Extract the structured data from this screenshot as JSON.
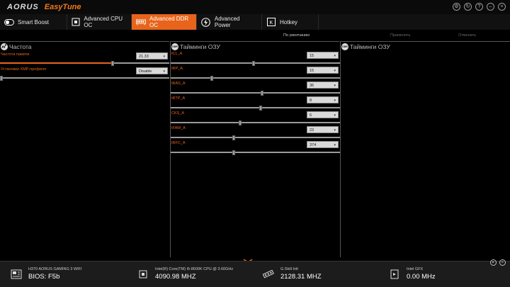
{
  "app": {
    "brand": "AORUS",
    "product": "EasyTune"
  },
  "window_controls": [
    "gear-icon",
    "refresh-icon",
    "help-icon",
    "minimize-icon",
    "close-icon"
  ],
  "tabs": [
    {
      "label": "Smart Boost",
      "icon": "toggle-icon"
    },
    {
      "label": "Advanced CPU OC",
      "icon": "cpu-icon"
    },
    {
      "label": "Advanced DDR OC",
      "icon": "ram-icon",
      "active": true
    },
    {
      "label": "Advanced Power",
      "icon": "lightning-icon"
    },
    {
      "label": "Hotkey",
      "icon": "keyboard-icon"
    }
  ],
  "actions": {
    "default": "По умолчанию",
    "apply": "Применить",
    "cancel": "Отменить"
  },
  "panel_frequency": {
    "title": "Частота",
    "memory_frequency": {
      "label": "Частота памяти",
      "value": "21.33",
      "slider": 0.67
    },
    "xmp_profile": {
      "label": "Установки XMP-профиля",
      "value": "Disable",
      "slider": 0.0
    }
  },
  "panel_timings": {
    "title": "Тайминги ОЗУ",
    "badge": "DDR",
    "rows": [
      {
        "label": "tCL_A",
        "value": "15",
        "slider": 0.49
      },
      {
        "label": "tRP_A",
        "value": "15",
        "slider": 0.24
      },
      {
        "label": "tRAS_A",
        "value": "36",
        "slider": 0.54
      },
      {
        "label": "tRTP_A",
        "value": "8",
        "slider": 0.53
      },
      {
        "label": "CKS_A",
        "value": "6",
        "slider": 0.41
      },
      {
        "label": "tFAW_A",
        "value": "23",
        "slider": 0.37
      },
      {
        "label": "tRFC_A",
        "value": "374",
        "slider": 0.37
      }
    ]
  },
  "panel_timings2": {
    "title": "Тайминги ОЗУ",
    "badge": "DDR"
  },
  "footer": {
    "board": {
      "name": "H370 AORUS GAMING 3 WIFI",
      "value": "BIOS: F5b"
    },
    "cpu": {
      "name": "Intel(R) Core(TM) i5-8600K CPU @ 3.60GHz",
      "value": "4090.98 MHZ"
    },
    "memory": {
      "name": "G.Skill Intl",
      "value": "2128.31 MHZ"
    },
    "gpu": {
      "name": "Intel GFX",
      "value": "0.00 MHz"
    }
  },
  "colors": {
    "accent": "#e8641b",
    "background": "#000000",
    "footer": "#1c1c1c"
  }
}
